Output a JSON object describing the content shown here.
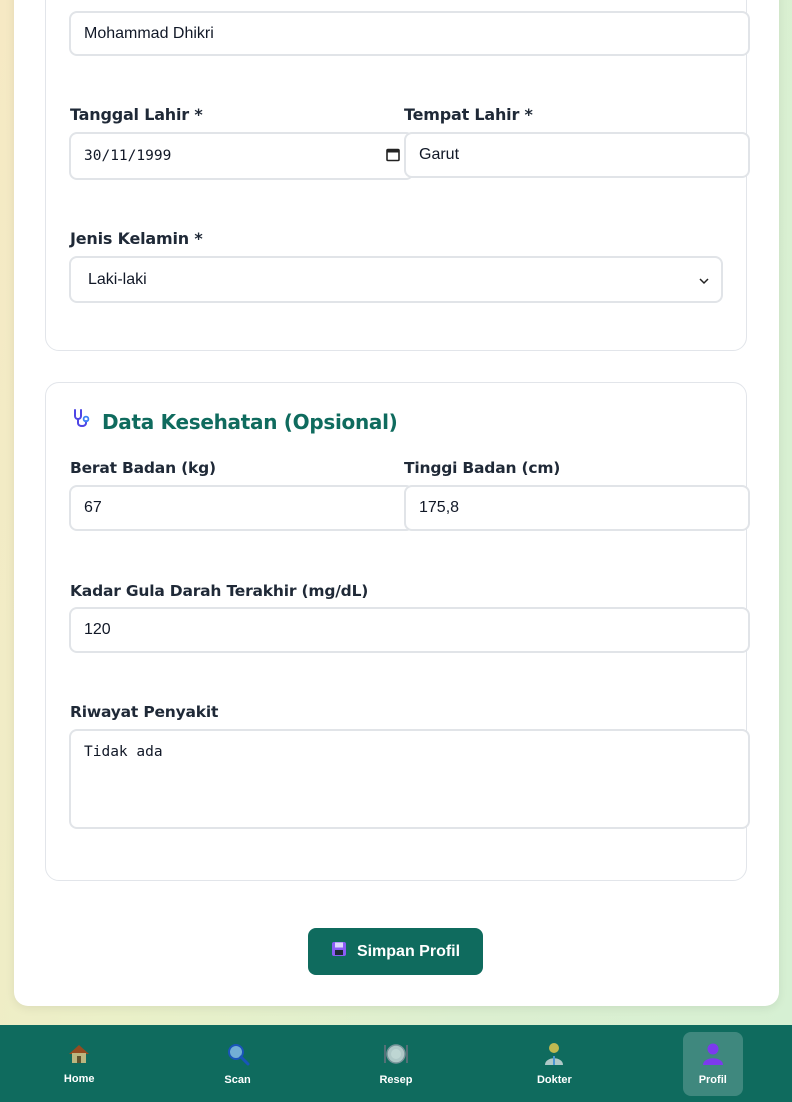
{
  "profile_form": {
    "full_name_value": "Mohammad Dhikri",
    "birth_date_label": "Tanggal Lahir *",
    "birth_date_value": "30/11/1999",
    "birth_place_label": "Tempat Lahir *",
    "birth_place_value": "Garut",
    "gender_label": "Jenis Kelamin *",
    "gender_value": "Laki-laki"
  },
  "health_section": {
    "title": "Data Kesehatan (Opsional)",
    "weight_label": "Berat Badan (kg)",
    "weight_value": "67",
    "height_label": "Tinggi Badan (cm)",
    "height_value": "175,8",
    "blood_sugar_label": "Kadar Gula Darah Terakhir (mg/dL)",
    "blood_sugar_value": "120",
    "history_label": "Riwayat Penyakit",
    "history_value": "Tidak ada"
  },
  "save_button": {
    "label": "Simpan Profil",
    "icon": "floppy-disk-icon"
  },
  "bottom_nav": {
    "items": [
      {
        "label": "Home",
        "icon": "house-icon",
        "active": false
      },
      {
        "label": "Scan",
        "icon": "magnifier-icon",
        "active": false
      },
      {
        "label": "Resep",
        "icon": "plate-icon",
        "active": false
      },
      {
        "label": "Dokter",
        "icon": "doctor-icon",
        "active": false
      },
      {
        "label": "Profil",
        "icon": "person-icon",
        "active": true
      }
    ]
  },
  "colors": {
    "brand": "#0f6b5e",
    "border": "#e1e4e8"
  }
}
